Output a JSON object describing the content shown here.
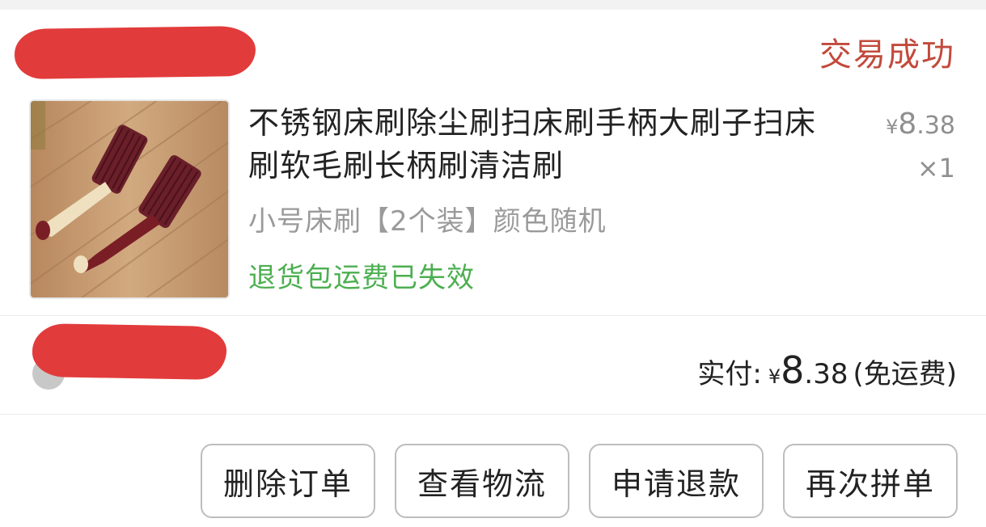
{
  "order": {
    "status": "交易成功"
  },
  "product": {
    "title": "不锈钢床刷除尘刷扫床刷手柄大刷子扫床刷软毛刷长柄刷清洁刷",
    "unit_price_currency": "¥",
    "unit_price_int": "8",
    "unit_price_dec": ".38",
    "quantity": "×1",
    "sku": "小号床刷【2个装】颜色随机",
    "return_notice": "退货包运费已失效",
    "image_icon": "bed-brush-photo"
  },
  "summary": {
    "paid_label": "实付:",
    "currency": "¥",
    "amount_int": "8",
    "amount_dec": ".38",
    "shipping_note": "(免运费)"
  },
  "actions": {
    "delete": "删除订单",
    "logistics": "查看物流",
    "refund": "申请退款",
    "reorder": "再次拼单"
  },
  "colors": {
    "status": "#c24a3c",
    "notice_green": "#4caf50",
    "redaction": "#e23b3b"
  }
}
